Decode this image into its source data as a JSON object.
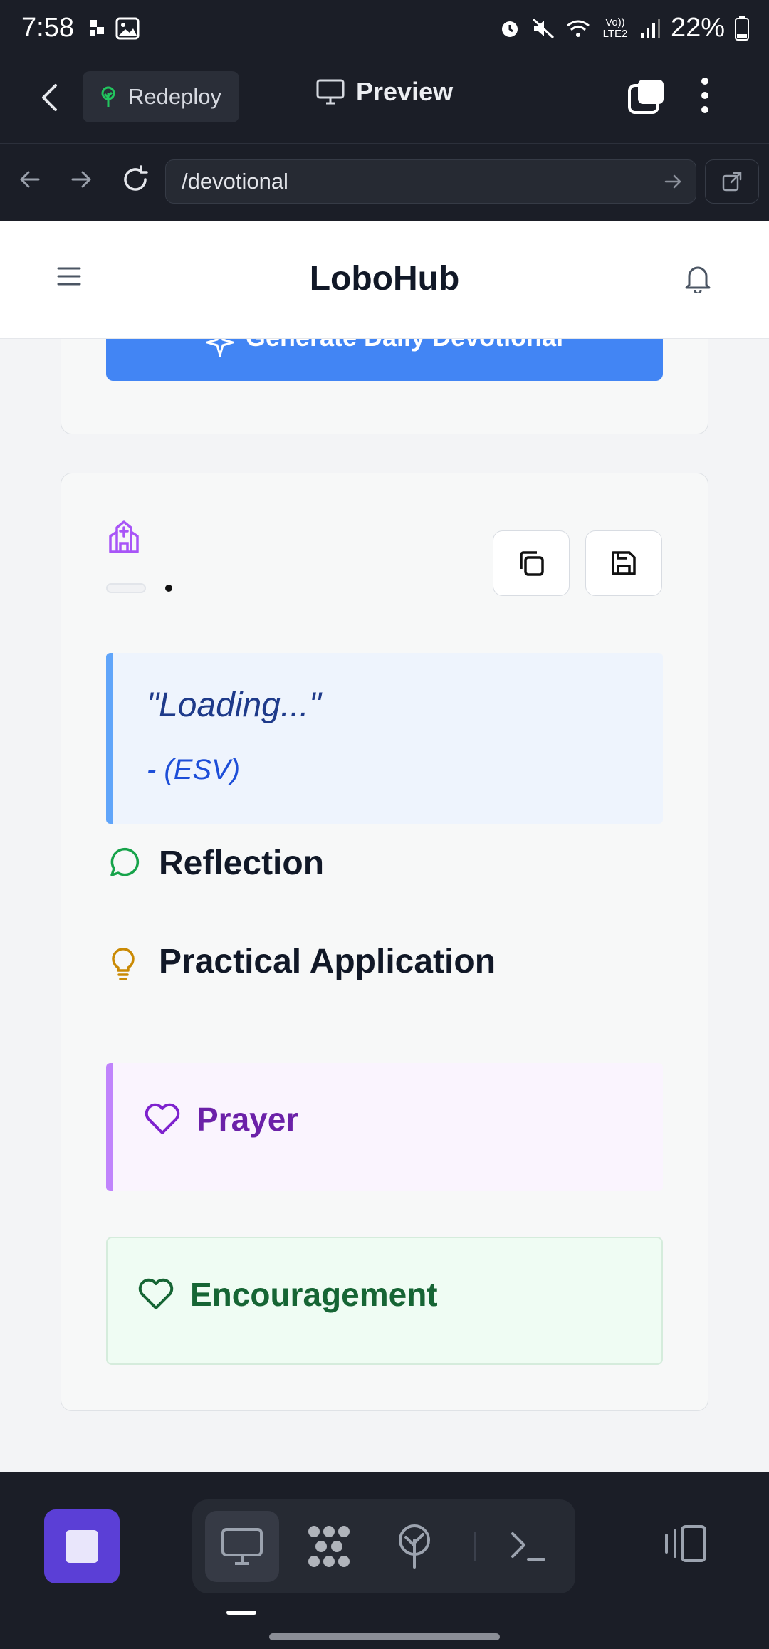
{
  "status_bar": {
    "time": "7:58",
    "network": "Vo)) LTE2",
    "battery": "22%"
  },
  "app_bar": {
    "redeploy_label": "Redeploy",
    "preview_label": "Preview"
  },
  "url_bar": {
    "path": "/devotional"
  },
  "site": {
    "brand": "LoboHub"
  },
  "generator": {
    "button_label": "Generate Daily Devotional"
  },
  "devotional": {
    "verse_text": "\"Loading...\"",
    "verse_reference": "- (ESV)",
    "reflection_title": "Reflection",
    "application_title": "Practical Application",
    "prayer_title": "Prayer",
    "encouragement_title": "Encouragement"
  },
  "colors": {
    "accent_blue": "#4285f4",
    "verse_border": "#60a5fa",
    "reflection_icon": "#16a34a",
    "application_icon": "#ca8a04",
    "prayer": "#7e22ce",
    "encouragement": "#166534",
    "church_icon": "#a855f7",
    "stop_button": "#5b3fd6"
  },
  "icons": {
    "status_left": [
      "notification-icon",
      "gallery-icon"
    ],
    "status_right": [
      "alarm-icon",
      "mute-icon",
      "wifi-icon",
      "signal-icon",
      "battery-icon"
    ],
    "bottom_toolbar": [
      "stop-icon",
      "desktop-icon",
      "nodes-icon",
      "deploy-icon",
      "terminal-icon",
      "device-switch-icon"
    ]
  }
}
